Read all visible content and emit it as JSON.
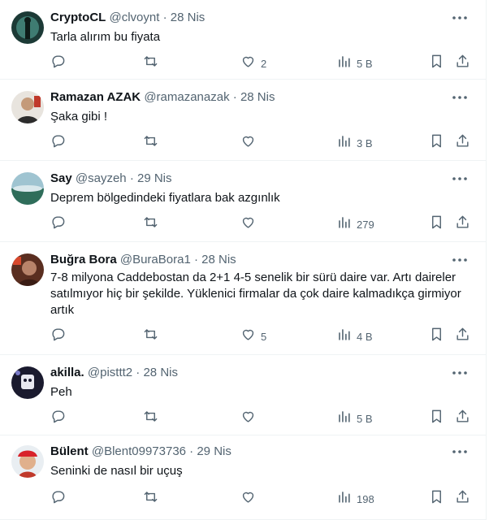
{
  "tweets": [
    {
      "name": "CryptoCL",
      "handle": "@clvoynt",
      "date": "28 Nis",
      "text": "Tarla alırım bu fiyata",
      "reply_count": "",
      "retweet_count": "",
      "like_count": "2",
      "views": "5 B"
    },
    {
      "name": "Ramazan AZAK",
      "handle": "@ramazanazak",
      "date": "28 Nis",
      "text": "Şaka gibi !",
      "reply_count": "",
      "retweet_count": "",
      "like_count": "",
      "views": "3 B"
    },
    {
      "name": "Say",
      "handle": "@sayzeh",
      "date": "29 Nis",
      "text": "Deprem bölgedindeki fiyatlara bak azgınlık",
      "reply_count": "",
      "retweet_count": "",
      "like_count": "",
      "views": "279"
    },
    {
      "name": "Buğra Bora",
      "handle": "@BuraBora1",
      "date": "28 Nis",
      "text": "7-8 milyona Caddebostan da 2+1 4-5 senelik bir sürü daire var. Artı daireler satılmıyor hiç bir şekilde. Yüklenici firmalar da çok daire kalmadıkça girmiyor artık",
      "reply_count": "",
      "retweet_count": "",
      "like_count": "5",
      "views": "4 B"
    },
    {
      "name": "akilla.",
      "handle": "@pisttt2",
      "date": "28 Nis",
      "text": "Peh",
      "reply_count": "",
      "retweet_count": "",
      "like_count": "",
      "views": "5 B"
    },
    {
      "name": "Bülent",
      "handle": "@Blent09973736",
      "date": "29 Nis",
      "text": "Seninki de nasıl bir uçuş",
      "reply_count": "",
      "retweet_count": "",
      "like_count": "",
      "views": "198"
    }
  ],
  "separator": "·",
  "colors": {
    "text": "#0f1419",
    "secondary": "#536471",
    "border": "#eff3f4"
  },
  "icons": {
    "reply": "reply-icon",
    "retweet": "retweet-icon",
    "like": "heart-icon",
    "views": "views-icon",
    "bookmark": "bookmark-icon",
    "share": "share-icon",
    "more": "more-dots-icon"
  }
}
